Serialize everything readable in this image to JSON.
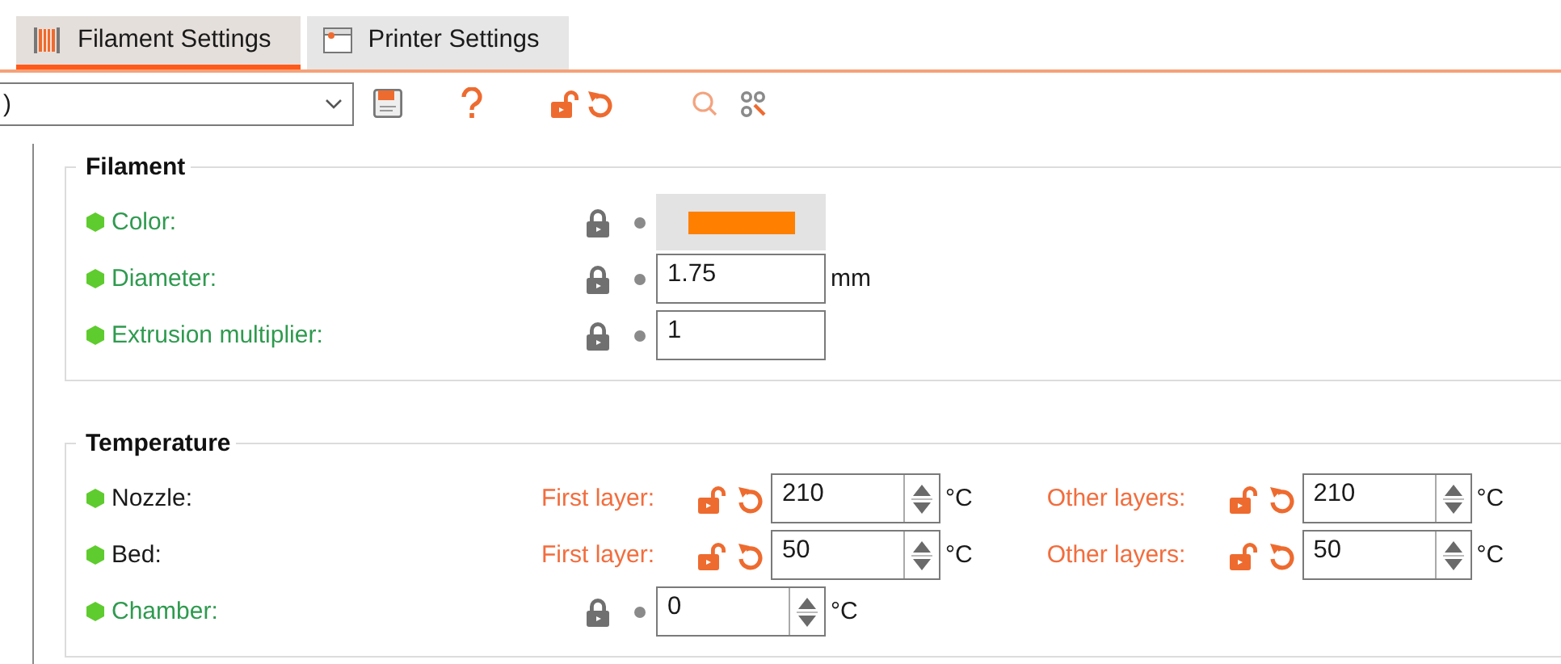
{
  "tabs": [
    {
      "label": "Filament Settings",
      "kind": "spool",
      "selected": true
    },
    {
      "label": "Printer Settings",
      "kind": "printer",
      "selected": false
    }
  ],
  "preset": {
    "value": ")"
  },
  "groups": [
    {
      "title": "Filament",
      "options": [
        {
          "label": "Color:",
          "system_value": true,
          "fields": [
            {
              "kind": "color",
              "system": true,
              "color": "#ff8000"
            }
          ]
        },
        {
          "label": "Diameter:",
          "system_value": true,
          "fields": [
            {
              "kind": "text",
              "system": true,
              "value": "1.75",
              "unit": "mm"
            }
          ]
        },
        {
          "label": "Extrusion multiplier:",
          "system_value": true,
          "fields": [
            {
              "kind": "text",
              "system": true,
              "value": "1"
            }
          ]
        }
      ]
    },
    {
      "title": "Temperature",
      "options": [
        {
          "label": "Nozzle:",
          "system_value": false,
          "fields": [
            {
              "kind": "spin",
              "system": false,
              "sidelabel": "First layer:",
              "value": "210",
              "unit": "°C"
            },
            {
              "kind": "spin",
              "system": false,
              "sidelabel": "Other layers:",
              "value": "210",
              "unit": "°C"
            }
          ]
        },
        {
          "label": "Bed:",
          "system_value": false,
          "fields": [
            {
              "kind": "spin",
              "system": false,
              "sidelabel": "First layer:",
              "value": "50",
              "unit": "°C"
            },
            {
              "kind": "spin",
              "system": false,
              "sidelabel": "Other layers:",
              "value": "50",
              "unit": "°C"
            }
          ]
        },
        {
          "label": "Chamber:",
          "system_value": true,
          "fields": [
            {
              "kind": "spin",
              "system": true,
              "value": "0",
              "unit": "°C"
            }
          ]
        }
      ]
    }
  ]
}
